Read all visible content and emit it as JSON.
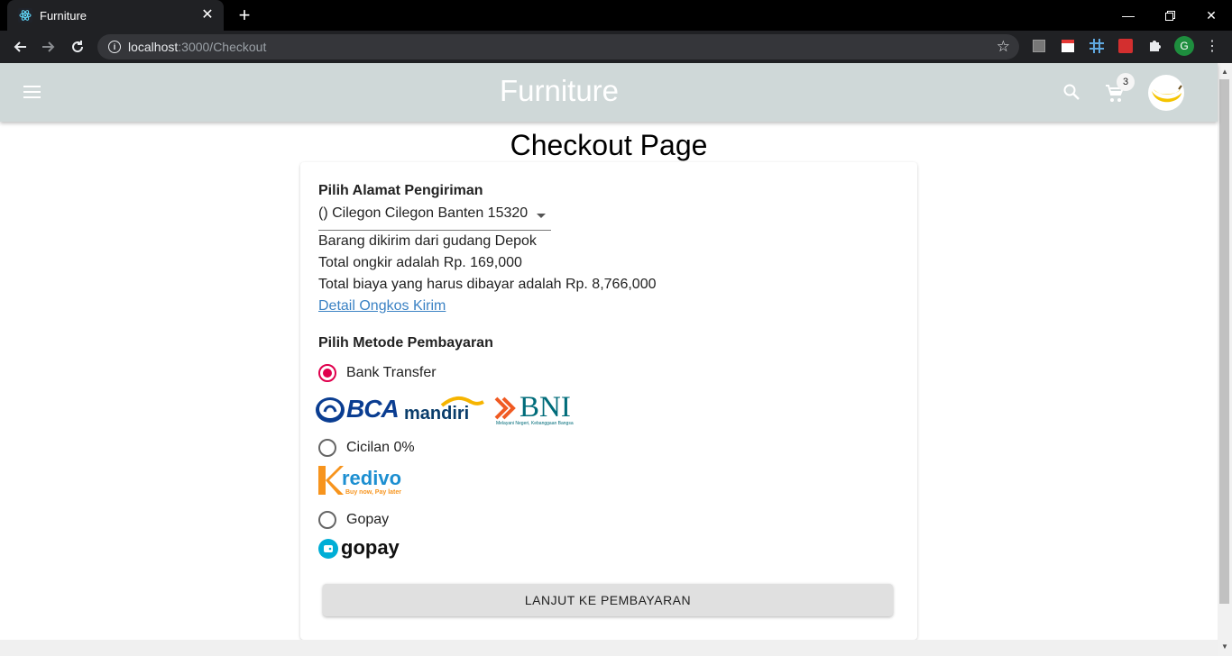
{
  "browser": {
    "tab_title": "Furniture",
    "url_host": "localhost",
    "url_path": ":3000/Checkout",
    "profile_initial": "G"
  },
  "app": {
    "brand": "Furniture",
    "cart_count": "3"
  },
  "checkout": {
    "page_title": "Checkout Page",
    "address_heading": "Pilih Alamat Pengiriman",
    "address_selected": "() Cilegon Cilegon Banten 15320",
    "warehouse_text": "Barang dikirim dari gudang Depok",
    "shipping_total": "Total ongkir adalah Rp. 169,000",
    "grand_total": "Total biaya yang harus dibayar adalah Rp. 8,766,000",
    "shipping_detail_link": "Detail Ongkos Kirim",
    "payment_heading": "Pilih Metode Pembayaran",
    "payment_options": [
      {
        "label": "Bank Transfer",
        "checked": true
      },
      {
        "label": "Cicilan 0%",
        "checked": false
      },
      {
        "label": "Gopay",
        "checked": false
      }
    ],
    "bank_logos": {
      "bca": "BCA",
      "mandiri": "mandiri",
      "bni": "BNI",
      "bni_tagline": "Melayani Negeri, Kebanggaan Bangsa"
    },
    "kredivo_logo": {
      "name": "redivo",
      "tagline": "Buy now, Pay later"
    },
    "gopay_logo": "gopay",
    "submit_label": "LANJUT KE PEMBAYARAN"
  },
  "colors": {
    "appbar": "#cfd8d8",
    "radio_accent": "#e0004d",
    "link": "#3b82c4"
  }
}
